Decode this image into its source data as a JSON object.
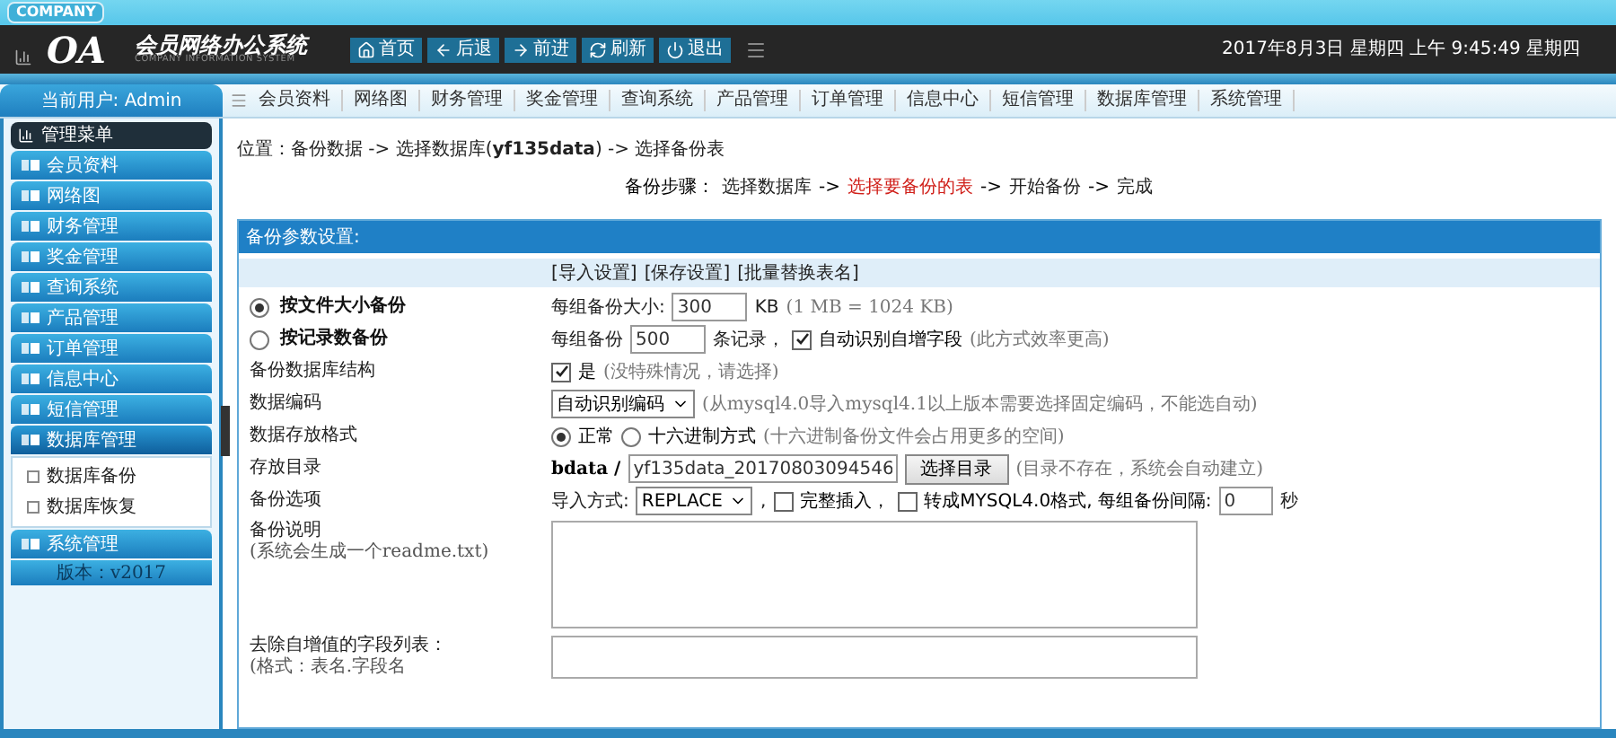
{
  "header": {
    "company_tag": "COMPANY",
    "logo_text": "OA",
    "title": "会员网络办公系统",
    "subtitle": "COMPANY INFORMATION SYSTEM",
    "nav_buttons": [
      {
        "kind": "home",
        "label": "首页"
      },
      {
        "kind": "back",
        "label": "后退"
      },
      {
        "kind": "forward",
        "label": "前进"
      },
      {
        "kind": "refresh",
        "label": "刷新"
      },
      {
        "kind": "exit",
        "label": "退出"
      }
    ],
    "datetime": "2017年8月3日 星期四 上午 9:45:49 星期四"
  },
  "user_label": "当前用户: Admin",
  "top_menu": [
    "会员资料",
    "网络图",
    "财务管理",
    "奖金管理",
    "查询系统",
    "产品管理",
    "订单管理",
    "信息中心",
    "短信管理",
    "数据库管理",
    "系统管理"
  ],
  "sidebar": {
    "title": "管理菜单",
    "items": [
      {
        "label": "会员资料",
        "expanded": false
      },
      {
        "label": "网络图",
        "expanded": false
      },
      {
        "label": "财务管理",
        "expanded": false
      },
      {
        "label": "奖金管理",
        "expanded": false
      },
      {
        "label": "查询系统",
        "expanded": false
      },
      {
        "label": "产品管理",
        "expanded": false
      },
      {
        "label": "订单管理",
        "expanded": false
      },
      {
        "label": "信息中心",
        "expanded": false
      },
      {
        "label": "短信管理",
        "expanded": false
      },
      {
        "label": "数据库管理",
        "expanded": true,
        "children": [
          {
            "label": "数据库备份"
          },
          {
            "label": "数据库恢复"
          }
        ]
      },
      {
        "label": "系统管理",
        "expanded": false
      }
    ],
    "version": "版本：v2017"
  },
  "breadcrumb": "位置：备份数据 -> 选择数据库(**yf135data**) -> 选择备份表",
  "steps": {
    "prefix": "备份步骤：",
    "separator": "->",
    "items": [
      {
        "label": "选择数据库",
        "selected": false
      },
      {
        "label": "选择要备份的表",
        "selected": true
      },
      {
        "label": "开始备份",
        "selected": false
      },
      {
        "label": "完成",
        "selected": false
      }
    ]
  },
  "panel": {
    "title": "备份参数设置:",
    "links": [
      "[导入设置]",
      "[保存设置]",
      "[批量替换表名]"
    ],
    "rows": [
      {
        "label": "按文件大小备份",
        "selected": true,
        "controls": [
          {
            "kind": "text",
            "text": "每组备份大小:"
          },
          {
            "kind": "input",
            "value": "300"
          },
          {
            "kind": "text",
            "text": "KB"
          },
          {
            "kind": "note",
            "text": "(1 MB = 1024 KB)"
          }
        ]
      },
      {
        "label": "按记录数备份",
        "selected": false,
        "controls": [
          {
            "kind": "text",
            "text": "每组备份"
          },
          {
            "kind": "input",
            "value": "500"
          },
          {
            "kind": "text",
            "text": "条记录，"
          },
          {
            "kind": "checkbox",
            "checked": true,
            "label": "自动识别自增字段"
          },
          {
            "kind": "note",
            "text": "(此方式效率更高)"
          }
        ]
      },
      {
        "label": "备份数据库结构",
        "controls": [
          {
            "kind": "checkbox",
            "checked": true,
            "label": "是"
          },
          {
            "kind": "note",
            "text": "(没特殊情况，请选择)"
          }
        ]
      },
      {
        "label": "数据编码",
        "controls": [
          {
            "kind": "select",
            "value": "自动识别编码"
          },
          {
            "kind": "note",
            "text": "(从mysql4.0导入mysql4.1以上版本需要选择固定编码，不能选自动)"
          }
        ]
      },
      {
        "label": "数据存放格式",
        "controls": [
          {
            "kind": "radio",
            "selected": true,
            "label": "正常"
          },
          {
            "kind": "radio",
            "selected": false,
            "label": "十六进制方式"
          },
          {
            "kind": "note",
            "text": "(十六进制备份文件会占用更多的空间)"
          }
        ]
      },
      {
        "label": "存放目录",
        "controls": [
          {
            "kind": "prefix",
            "text": "bdata /"
          },
          {
            "kind": "input",
            "value": "yf135data_20170803094546"
          },
          {
            "kind": "button",
            "label": "选择目录"
          },
          {
            "kind": "note",
            "text": "(目录不存在，系统会自动建立)"
          }
        ]
      },
      {
        "label": "备份选项",
        "controls": [
          {
            "kind": "text",
            "text": "导入方式:"
          },
          {
            "kind": "select",
            "value": "REPLACE"
          },
          {
            "kind": "text",
            "text": ","
          },
          {
            "kind": "checkbox",
            "checked": false,
            "label": "完整插入，"
          },
          {
            "kind": "checkbox",
            "checked": false,
            "label": "转成MYSQL4.0格式, 每组备份间隔:"
          },
          {
            "kind": "input",
            "value": "0"
          },
          {
            "kind": "text",
            "text": "秒"
          }
        ]
      },
      {
        "label": "备份说明",
        "sublabel": "(系统会生成一个readme.txt)",
        "controls": [
          {
            "kind": "textarea"
          }
        ]
      },
      {
        "label": "去除自增值的字段列表：",
        "sublabel": "(格式：表名.字段名",
        "controls": [
          {
            "kind": "textarea"
          }
        ]
      }
    ]
  }
}
